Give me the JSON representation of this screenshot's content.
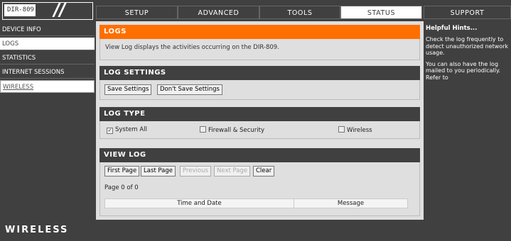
{
  "header": {
    "model": "DIR-809",
    "tabs": [
      {
        "label": "SETUP"
      },
      {
        "label": "ADVANCED"
      },
      {
        "label": "TOOLS"
      },
      {
        "label": "STATUS"
      },
      {
        "label": "SUPPORT"
      }
    ]
  },
  "sidebar": {
    "items": [
      {
        "label": "DEVICE INFO"
      },
      {
        "label": "LOGS"
      },
      {
        "label": "STATISTICS"
      },
      {
        "label": "INTERNET SESSIONS"
      },
      {
        "label": "WIRELESS"
      }
    ]
  },
  "logs": {
    "title": "LOGS",
    "description": "View Log displays the activities occurring on the DIR-809."
  },
  "log_settings": {
    "title": "LOG SETTINGS",
    "save_label": "Save Settings",
    "dont_save_label": "Don't Save Settings"
  },
  "log_type": {
    "title": "LOG TYPE",
    "options": [
      {
        "label": "System All",
        "checked": true
      },
      {
        "label": "Firewall & Security",
        "checked": false
      },
      {
        "label": "Wireless",
        "checked": false
      }
    ]
  },
  "view_log": {
    "title": "VIEW LOG",
    "buttons": {
      "first": "First Page",
      "last": "Last Page",
      "previous": "Previous",
      "next": "Next Page",
      "clear": "Clear"
    },
    "page_info": "Page 0 of 0",
    "columns": [
      "Time and Date",
      "Message"
    ]
  },
  "hints": {
    "title": "Helpful Hints...",
    "p1": "Check the log frequently to detect unauthorized network usage.",
    "p2": "You can also have the log mailed to you periodically. Refer to"
  },
  "footer": {
    "brand": "WIRELESS"
  },
  "colors": {
    "accent": "#ff6f00",
    "dark": "#404040",
    "panel": "#dfdfdf"
  }
}
